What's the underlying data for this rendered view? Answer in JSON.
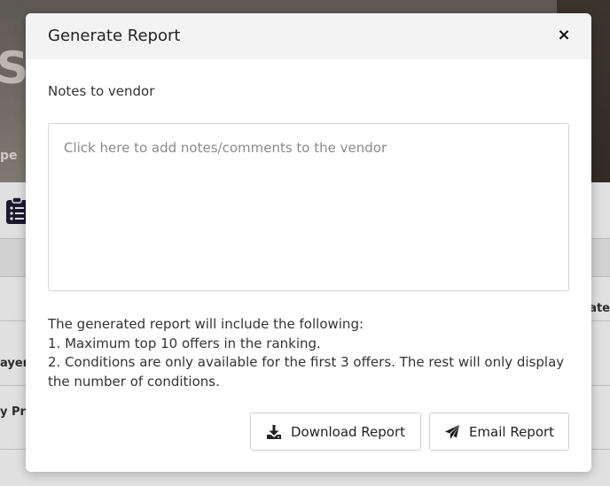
{
  "background": {
    "hero_title_fragment": "Su",
    "hero_sub_fragment": "pe",
    "row_labels_left": [
      "ayer",
      "y Pri"
    ],
    "row_label_right": "ate",
    "toolbar_icon": "clipboard-list-icon"
  },
  "modal": {
    "title": "Generate Report",
    "close_icon": "close-icon",
    "close_label": "×",
    "notes_label": "Notes to vendor",
    "notes_placeholder": "Click here to add notes/comments to the vendor",
    "notes_value": "",
    "info_lines": [
      "The generated report will include the following:",
      "1. Maximum top 10 offers in the ranking.",
      "2. Conditions are only available for the first 3 offers. The rest will only display the number of conditions."
    ],
    "buttons": {
      "download": {
        "label": "Download Report",
        "icon": "download-icon"
      },
      "email": {
        "label": "Email Report",
        "icon": "paper-plane-icon"
      }
    }
  },
  "colors": {
    "modal_header_bg": "#f3f3f3",
    "text": "#333333",
    "border": "#d5d5d5",
    "placeholder": "#8a8a8a"
  }
}
